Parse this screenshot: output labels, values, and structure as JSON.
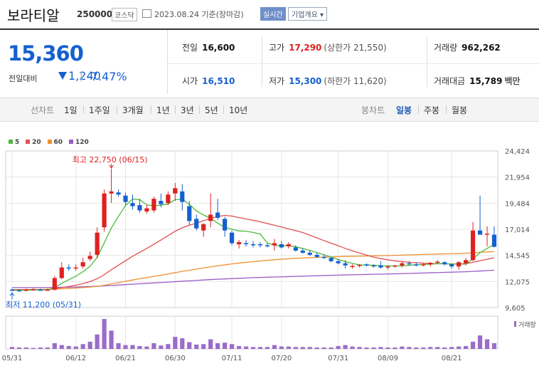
{
  "header": {
    "name": "보라티알",
    "code": "250000",
    "market": "코스닥",
    "date_label": "2023.08.24 기준(장마감)",
    "realtime_label": "실시간",
    "info_label": "기업개요 ▾"
  },
  "quote": {
    "price": "15,360",
    "change_label": "전일대비",
    "change": "1,240",
    "change_pct": "-7.47%",
    "prev_label": "전일",
    "prev": "16,600",
    "high_label": "고가",
    "high": "17,290",
    "upper_limit": "(상한가 21,550)",
    "volume_label": "거래량",
    "volume": "962,262",
    "open_label": "시가",
    "open": "16,510",
    "low_label": "저가",
    "low": "15,300",
    "lower_limit": "(하한가 11,620)",
    "amount_label": "거래대금",
    "amount": "15,789",
    "amount_unit": "백만"
  },
  "toolbar": {
    "line_chart_label": "선차트",
    "periods": [
      "1일",
      "1주일",
      "3개월",
      "1년",
      "3년",
      "5년",
      "10년"
    ],
    "candle_label": "봉차트",
    "candle_periods": [
      "일봉",
      "주봉",
      "월봉"
    ],
    "selected_candle": "일봉"
  },
  "colors": {
    "up": "#e02020",
    "down": "#1560cf",
    "ma5": "#4cbb3c",
    "ma20": "#e05050",
    "ma60": "#f09030",
    "ma120": "#9a5bc8",
    "volume": "#9b6cc9"
  },
  "chart_data": {
    "type": "candlestick",
    "legend": [
      "5",
      "20",
      "60",
      "120"
    ],
    "annotations": {
      "high": "최고 22,750 (06/15)",
      "low": "최저 11,200 (05/31)"
    },
    "ylim": [
      9605,
      24424
    ],
    "yticks": [
      "24,424",
      "21,954",
      "19,484",
      "17,014",
      "14,545",
      "12,075",
      "9,605"
    ],
    "xticks": [
      "05/31",
      "06/12",
      "06/21",
      "06/30",
      "07/11",
      "07/20",
      "07/31",
      "08/09",
      "08/21"
    ],
    "volume_label": "거래량",
    "candles": [
      [
        11300,
        11400,
        11150,
        11250
      ],
      [
        11250,
        11350,
        11100,
        11200
      ],
      [
        11200,
        11400,
        11150,
        11300
      ],
      [
        11300,
        11450,
        11200,
        11350
      ],
      [
        11300,
        11400,
        11200,
        11280
      ],
      [
        11300,
        11400,
        11200,
        11300
      ],
      [
        11300,
        12600,
        11200,
        12400
      ],
      [
        12400,
        13900,
        12300,
        13400
      ],
      [
        13400,
        13700,
        13100,
        13350
      ],
      [
        13350,
        13700,
        13100,
        13400
      ],
      [
        13500,
        14300,
        13300,
        13900
      ],
      [
        14200,
        14900,
        14000,
        14500
      ],
      [
        14600,
        17200,
        14300,
        16700
      ],
      [
        17200,
        20800,
        16800,
        20400
      ],
      [
        20400,
        22750,
        19500,
        20600
      ],
      [
        20500,
        20800,
        20100,
        20300
      ],
      [
        20200,
        20500,
        19300,
        19600
      ],
      [
        19500,
        20300,
        18900,
        19200
      ],
      [
        19300,
        19900,
        18600,
        18800
      ],
      [
        18700,
        19300,
        18500,
        19000
      ],
      [
        18800,
        20100,
        18600,
        19900
      ],
      [
        19700,
        20400,
        19100,
        19400
      ],
      [
        19500,
        20600,
        19300,
        20300
      ],
      [
        20400,
        21400,
        19700,
        20900
      ],
      [
        20600,
        21300,
        18800,
        19600
      ],
      [
        19200,
        19700,
        17400,
        17800
      ],
      [
        18000,
        18400,
        16900,
        17100
      ],
      [
        16900,
        17600,
        16300,
        17500
      ],
      [
        17800,
        20400,
        17200,
        18400
      ],
      [
        18600,
        19900,
        17900,
        18100
      ],
      [
        18000,
        18200,
        16300,
        16900
      ],
      [
        16700,
        16900,
        15500,
        15700
      ],
      [
        15600,
        16000,
        15200,
        15800
      ],
      [
        15700,
        16000,
        15400,
        15600
      ],
      [
        15600,
        15900,
        15300,
        15550
      ],
      [
        15600,
        15800,
        15300,
        15500
      ],
      [
        15500,
        15700,
        15300,
        15400
      ],
      [
        15500,
        16100,
        15000,
        15700
      ],
      [
        15600,
        15900,
        15200,
        15300
      ],
      [
        15400,
        15800,
        15200,
        15600
      ],
      [
        15300,
        15500,
        14900,
        15000
      ],
      [
        15000,
        15200,
        14700,
        14800
      ],
      [
        14800,
        15000,
        14500,
        14600
      ],
      [
        14600,
        14800,
        14300,
        14400
      ],
      [
        14400,
        14600,
        14200,
        14300
      ],
      [
        14300,
        14400,
        13900,
        14000
      ],
      [
        14000,
        14200,
        13700,
        13800
      ],
      [
        13800,
        14100,
        13300,
        13600
      ],
      [
        13500,
        13700,
        13300,
        13550
      ],
      [
        13600,
        13700,
        13400,
        13650
      ],
      [
        13700,
        13800,
        13500,
        13600
      ],
      [
        13600,
        13700,
        13400,
        13550
      ],
      [
        13600,
        14000,
        13300,
        13400
      ],
      [
        13400,
        13600,
        13200,
        13500
      ],
      [
        13500,
        13650,
        13400,
        13600
      ],
      [
        13600,
        14000,
        13400,
        13800
      ],
      [
        13800,
        14000,
        13600,
        13700
      ],
      [
        13700,
        13900,
        13500,
        13650
      ],
      [
        13650,
        13800,
        13500,
        13700
      ],
      [
        13700,
        13900,
        13500,
        13850
      ],
      [
        13850,
        14100,
        13700,
        13950
      ],
      [
        13900,
        14000,
        13600,
        13700
      ],
      [
        13700,
        13800,
        13300,
        13500
      ],
      [
        13500,
        14000,
        13200,
        13900
      ],
      [
        13800,
        14300,
        13600,
        14100
      ],
      [
        14100,
        17700,
        14000,
        16900
      ],
      [
        16900,
        20200,
        16500,
        16500
      ],
      [
        16500,
        17300,
        15400,
        16600
      ],
      [
        16510,
        17290,
        15300,
        15360
      ]
    ],
    "ma5": [
      11250,
      11250,
      11250,
      11270,
      11280,
      11290,
      11510,
      11900,
      12250,
      12570,
      13010,
      13510,
      14370,
      15730,
      17140,
      18240,
      19260,
      19880,
      19820,
      19330,
      19230,
      19310,
      19400,
      19820,
      19860,
      19370,
      18760,
      18370,
      18050,
      17590,
      17210,
      17020,
      16860,
      16830,
      16720,
      16560,
      15720,
      15500,
      15460,
      15460,
      15360,
      15200,
      15020,
      14820,
      14600,
      14380,
      14160,
      13960,
      13790,
      13650,
      13630,
      13620,
      13570,
      13560,
      13520,
      13570,
      13600,
      13650,
      13690,
      13710,
      13770,
      13770,
      13730,
      13720,
      13720,
      14220,
      14800,
      15210,
      15580
    ],
    "ma20": [
      11300,
      11300,
      11300,
      11310,
      11310,
      11320,
      11390,
      11500,
      11610,
      11730,
      11880,
      12070,
      12340,
      12720,
      13190,
      13620,
      14040,
      14460,
      14840,
      15210,
      15600,
      16000,
      16410,
      16830,
      17160,
      17400,
      17590,
      17830,
      18040,
      18230,
      18330,
      18270,
      18120,
      17990,
      17860,
      17720,
      17560,
      17390,
      17230,
      17050,
      16890,
      16700,
      16460,
      16200,
      15940,
      15700,
      15460,
      15200,
      14980,
      14780,
      14570,
      14380,
      14240,
      14130,
      14030,
      13960,
      13890,
      13850,
      13810,
      13790,
      13760,
      13750,
      13730,
      13740,
      13760,
      13890,
      14040,
      14180,
      14310
    ],
    "ma60": [
      11300,
      11300,
      11310,
      11320,
      11330,
      11340,
      11360,
      11390,
      11420,
      11460,
      11500,
      11550,
      11620,
      11720,
      11850,
      11970,
      12100,
      12220,
      12340,
      12450,
      12560,
      12670,
      12790,
      12910,
      13030,
      13140,
      13250,
      13360,
      13460,
      13560,
      13650,
      13740,
      13820,
      13890,
      13960,
      14020,
      14080,
      14130,
      14180,
      14220,
      14260,
      14300,
      14330,
      14360,
      14390,
      14410,
      14430,
      14450,
      14460,
      14480,
      14490,
      14510,
      14520,
      14540,
      14550,
      14570,
      14590,
      14610,
      14630,
      14650,
      14670,
      14690,
      14700,
      14720,
      14750,
      14790,
      14840,
      14880,
      14910
    ],
    "ma120": [
      11500,
      11500,
      11500,
      11500,
      11510,
      11510,
      11520,
      11530,
      11540,
      11560,
      11580,
      11600,
      11630,
      11660,
      11700,
      11740,
      11780,
      11820,
      11860,
      11900,
      11940,
      11980,
      12020,
      12060,
      12100,
      12140,
      12180,
      12220,
      12260,
      12290,
      12320,
      12350,
      12380,
      12410,
      12440,
      12460,
      12480,
      12500,
      12520,
      12540,
      12560,
      12580,
      12600,
      12620,
      12640,
      12660,
      12680,
      12700,
      12710,
      12730,
      12740,
      12760,
      12770,
      12790,
      12800,
      12820,
      12840,
      12860,
      12880,
      12900,
      12920,
      12940,
      12960,
      12980,
      13000,
      13030,
      13070,
      13110,
      13150
    ],
    "volume": [
      4,
      3,
      3,
      2,
      3,
      3,
      12,
      8,
      6,
      5,
      10,
      15,
      30,
      62,
      38,
      12,
      8,
      8,
      6,
      5,
      12,
      7,
      10,
      25,
      22,
      14,
      9,
      10,
      20,
      12,
      13,
      10,
      6,
      5,
      4,
      4,
      4,
      8,
      5,
      5,
      4,
      4,
      4,
      3,
      3,
      3,
      6,
      8,
      5,
      4,
      3,
      3,
      4,
      3,
      3,
      5,
      4,
      3,
      3,
      4,
      4,
      3,
      4,
      5,
      6,
      15,
      28,
      20,
      12
    ]
  }
}
